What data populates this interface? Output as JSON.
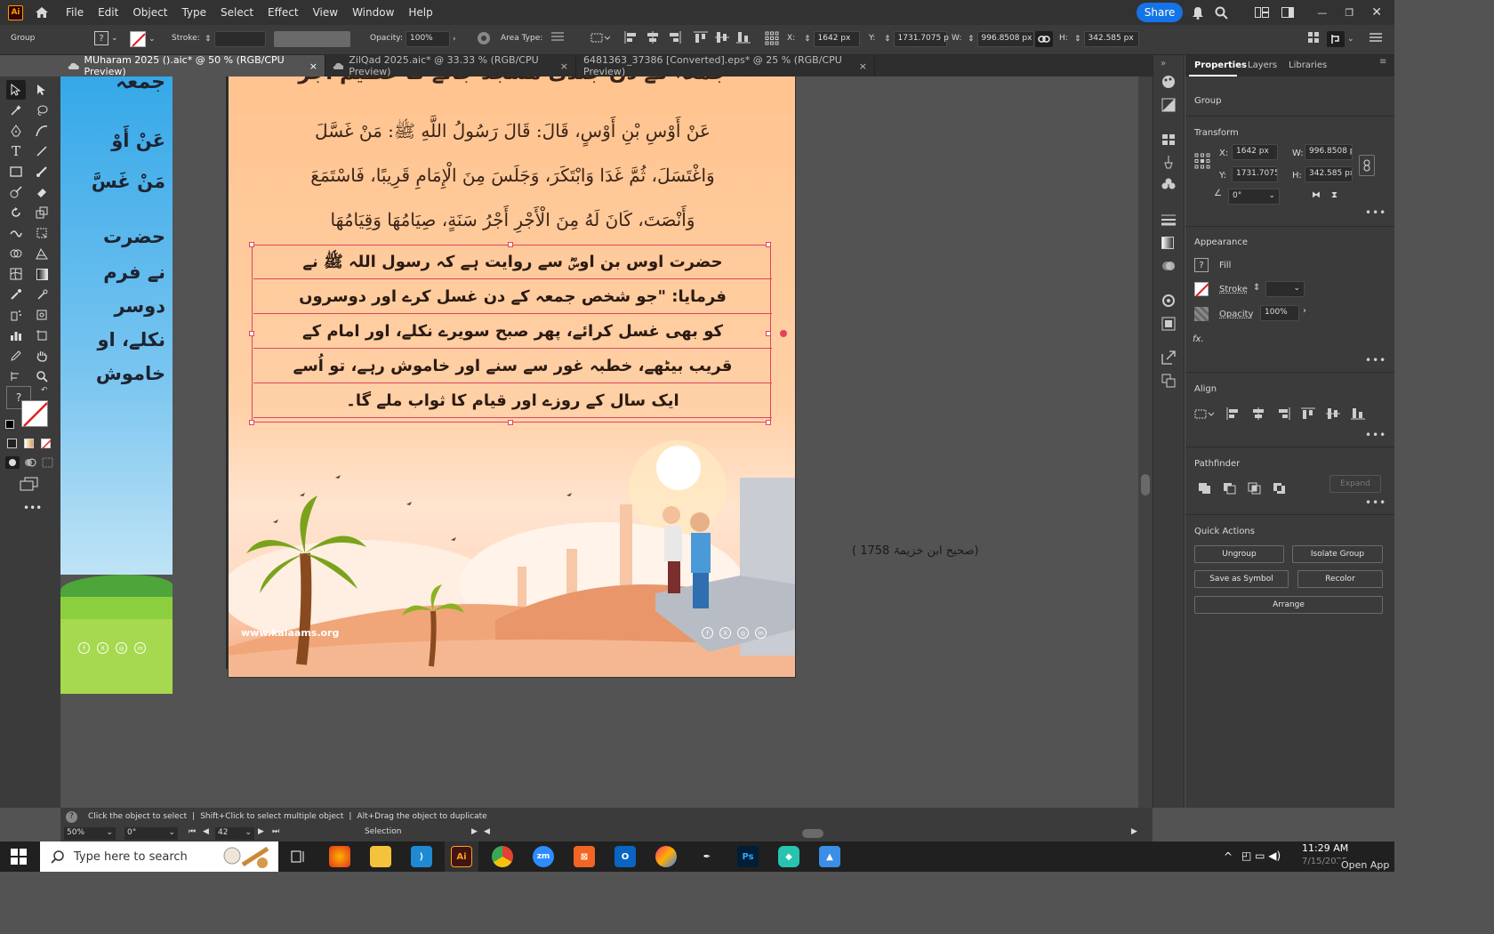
{
  "app": {
    "logo": "Ai",
    "accent": "#ff9a00",
    "share_color": "#1473e6"
  },
  "menu": [
    "File",
    "Edit",
    "Object",
    "Type",
    "Select",
    "Effect",
    "View",
    "Window",
    "Help"
  ],
  "header": {
    "share_label": "Share"
  },
  "control": {
    "selection_type": "Group",
    "stroke_label": "Stroke:",
    "opacity_label": "Opacity:",
    "opacity_value": "100%",
    "area_type_label": "Area Type:",
    "x_label": "X:",
    "x_value": "1642 px",
    "y_label": "Y:",
    "y_value": "1731.7075 p",
    "w_label": "W:",
    "w_value": "996.8508 px",
    "h_label": "H:",
    "h_value": "342.585 px"
  },
  "tabs": [
    {
      "label": "MUharam 2025 ().aic* @ 50 % (RGB/CPU Preview)",
      "close": "×"
    },
    {
      "label": "ZilQad 2025.aic* @ 33.33 % (RGB/CPU Preview)",
      "close": "×"
    },
    {
      "label": "6481363_37386 [Converted].eps* @ 25 % (RGB/CPU Preview)",
      "close": "×"
    }
  ],
  "artboard": {
    "heading_partial": "جمعہ کے دن جلدی مسجد جانے کا عظیم اجر",
    "arabic_lines": [
      "عَنْ أَوْسِ بْنِ أَوْسٍ، قَالَ: قَالَ رَسُولُ اللَّهِ ﷺ: مَنْ غَسَّلَ",
      "وَاغْتَسَلَ، ثُمَّ غَدَا وَابْتَكَرَ، وَجَلَسَ مِنَ الْإِمَامِ قَرِيبًا، فَاسْتَمَعَ",
      "وَأَنْصَتَ، كَانَ لَهُ مِنَ الْأَجْرِ أَجْرُ سَنَةٍ، صِيَامُهَا وَقِيَامُهَا"
    ],
    "urdu_lines": [
      "حضرت اوس بن اوسؓ سے روایت ہے کہ رسول اللہ ﷺ نے",
      "فرمایا: \"جو شخص جمعہ کے دن غسل کرے اور دوسروں",
      "کو بھی غسل کرائے، پھر صبح سویرے نکلے، اور امام کے",
      "قریب بیٹھے، خطبہ غور سے سنے اور خاموش رہے، تو اُسے",
      "ایک سال کے روزے اور قیام کا ثواب ملے گا۔"
    ],
    "website": "www.kalaams.org",
    "reference": "(صحیح ابن خزیمۃ 1758 )"
  },
  "left_artboard": {
    "lines": [
      "جمعہ",
      "عَنْ أَوْ",
      "مَنْ غَسَّ",
      "حضرت",
      "نے فرم",
      "دوسر",
      "نکلے، او",
      "خاموش"
    ]
  },
  "panel": {
    "tabs": [
      "Properties",
      "Layers",
      "Libraries"
    ],
    "group_label": "Group",
    "transform_title": "Transform",
    "x_label": "X:",
    "x_value": "1642 px",
    "y_label": "Y:",
    "y_value": "1731.7075",
    "w_label": "W:",
    "w_value": "996.8508 p",
    "h_label": "H:",
    "h_value": "342.585 px",
    "angle_value": "0°",
    "appearance_title": "Appearance",
    "fill_label": "Fill",
    "stroke_label": "Stroke",
    "opacity_label": "Opacity",
    "opacity_value": "100%",
    "fx_label": "fx.",
    "align_title": "Align",
    "pathfinder_title": "Pathfinder",
    "expand_label": "Expand",
    "quick_actions_title": "Quick Actions",
    "actions": [
      "Ungroup",
      "Isolate Group",
      "Save as Symbol",
      "Recolor",
      "Arrange"
    ]
  },
  "status": {
    "hint_1": "Click the object to select",
    "hint_2": "Shift+Click to select multiple object",
    "hint_3": "Alt+Drag the object to duplicate",
    "zoom": "50%",
    "rotation": "0°",
    "artboard_num": "42",
    "tool_name": "Selection"
  },
  "taskbar": {
    "search_placeholder": "Type here to search",
    "time": "11:29 AM",
    "date": "7/15/2025",
    "open_app": "Open App"
  }
}
